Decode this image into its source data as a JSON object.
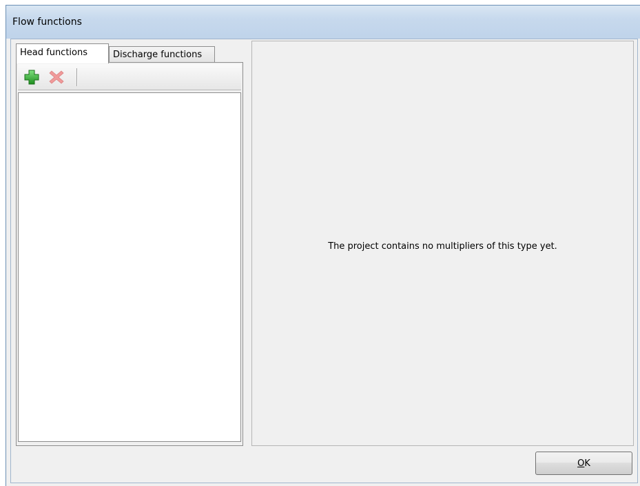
{
  "window": {
    "title": "Flow functions"
  },
  "tabs": [
    {
      "label": "Head functions",
      "active": true
    },
    {
      "label": "Discharge functions",
      "active": false
    }
  ],
  "toolbar": {
    "add_icon": "plus-icon",
    "delete_icon": "delete-x-icon"
  },
  "detail": {
    "empty_message": "The project contains no multipliers of this type yet."
  },
  "footer": {
    "ok_label_mnemonic": "O",
    "ok_label_rest": "K"
  },
  "colors": {
    "add_green": "#2aa52a",
    "delete_red": "#e96b6b",
    "titlebar": "#c7d9ed"
  }
}
